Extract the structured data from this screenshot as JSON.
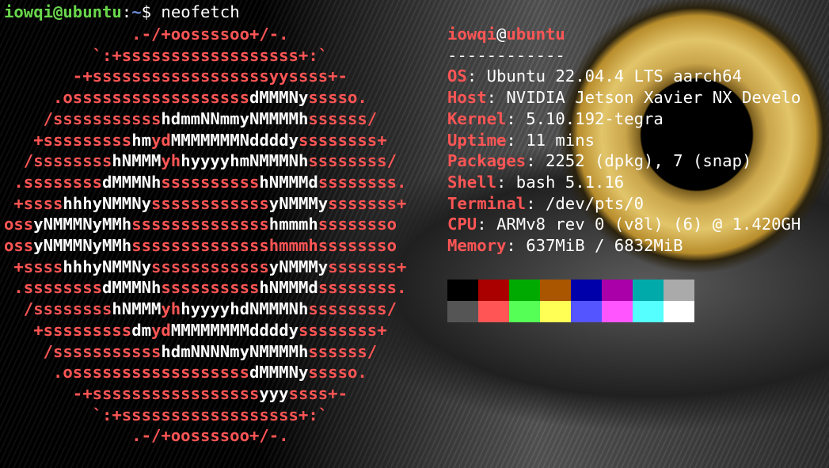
{
  "prompt": {
    "user_host": "iowqi@ubuntu",
    "separator": ":",
    "path": "~",
    "symbol": "$",
    "command": " neofetch"
  },
  "logo": {
    "colors": {
      "primary": "#ff5555",
      "secondary": "#ffffff"
    },
    "lines": [
      [
        [
          "r",
          "             .-/+oossssoo+/-."
        ]
      ],
      [
        [
          "r",
          "         `:+ssssssssssssssssss+:`"
        ]
      ],
      [
        [
          "r",
          "       -+ssssssssssssssssssyyssss+-"
        ]
      ],
      [
        [
          "r",
          "     .ossssssssssssssssss"
        ],
        [
          "w",
          "dMMMNy"
        ],
        [
          "r",
          "sssso."
        ]
      ],
      [
        [
          "r",
          "    /sssssssssss"
        ],
        [
          "w",
          "hdmmNNmmyNMMMMh"
        ],
        [
          "r",
          "ssssss/"
        ]
      ],
      [
        [
          "r",
          "   +sssssssss"
        ],
        [
          "w",
          "hm"
        ],
        [
          "r",
          "yd"
        ],
        [
          "w",
          "MMMMMMMNddddy"
        ],
        [
          "r",
          "ssssssss+"
        ]
      ],
      [
        [
          "r",
          "  /ssssssss"
        ],
        [
          "w",
          "hNMMM"
        ],
        [
          "r",
          "yh"
        ],
        [
          "w",
          "hyyyyhmNMMMNh"
        ],
        [
          "r",
          "ssssssss/"
        ]
      ],
      [
        [
          "r",
          " .ssssssss"
        ],
        [
          "w",
          "dMMMNh"
        ],
        [
          "r",
          "ssssssssss"
        ],
        [
          "w",
          "hNMMMd"
        ],
        [
          "r",
          "ssssssss."
        ]
      ],
      [
        [
          "r",
          " +ssss"
        ],
        [
          "w",
          "hhhyNMMNy"
        ],
        [
          "r",
          "ssssssssssss"
        ],
        [
          "w",
          "yNMMMy"
        ],
        [
          "r",
          "sssssss+"
        ]
      ],
      [
        [
          "r",
          "oss"
        ],
        [
          "w",
          "yNMMMNyMMh"
        ],
        [
          "r",
          "ssssssssssssss"
        ],
        [
          "w",
          "hmmmh"
        ],
        [
          "r",
          "ssssssso"
        ]
      ],
      [
        [
          "r",
          "oss"
        ],
        [
          "w",
          "yNMMMNyMMh"
        ],
        [
          "r",
          "sssssssssssssshmmmhssssssso"
        ]
      ],
      [
        [
          "r",
          " +ssss"
        ],
        [
          "w",
          "hhhyNMMNy"
        ],
        [
          "r",
          "ssssssssssss"
        ],
        [
          "w",
          "yNMMMy"
        ],
        [
          "r",
          "sssssss+"
        ]
      ],
      [
        [
          "r",
          " .ssssssss"
        ],
        [
          "w",
          "dMMMNh"
        ],
        [
          "r",
          "ssssssssss"
        ],
        [
          "w",
          "hNMMMd"
        ],
        [
          "r",
          "ssssssss."
        ]
      ],
      [
        [
          "r",
          "  /ssssssss"
        ],
        [
          "w",
          "hNMMM"
        ],
        [
          "r",
          "yh"
        ],
        [
          "w",
          "hyyyyhdNMMMNh"
        ],
        [
          "r",
          "ssssssss/"
        ]
      ],
      [
        [
          "r",
          "   +sssssssss"
        ],
        [
          "w",
          "dm"
        ],
        [
          "r",
          "yd"
        ],
        [
          "w",
          "MMMMMMMMddddy"
        ],
        [
          "r",
          "ssssssss+"
        ]
      ],
      [
        [
          "r",
          "    /sssssssssss"
        ],
        [
          "w",
          "hdmNNNNmyNMMMMh"
        ],
        [
          "r",
          "ssssss/"
        ]
      ],
      [
        [
          "r",
          "     .ossssssssssssssssss"
        ],
        [
          "w",
          "dMMMNy"
        ],
        [
          "r",
          "sssso."
        ]
      ],
      [
        [
          "r",
          "       -+sssssssssssssssss"
        ],
        [
          "w",
          "yyy"
        ],
        [
          "r",
          "ssss+-"
        ]
      ],
      [
        [
          "r",
          "         `:+ssssssssssssssssss+:`"
        ]
      ],
      [
        [
          "r",
          "             .-/+oossssoo+/-."
        ]
      ]
    ]
  },
  "info": {
    "title_user": "iowqi",
    "title_at": "@",
    "title_host": "ubuntu",
    "divider": "------------",
    "rows": [
      {
        "label": "OS",
        "value": ": Ubuntu 22.04.4 LTS aarch64"
      },
      {
        "label": "Host",
        "value": ": NVIDIA Jetson Xavier NX Develo"
      },
      {
        "label": "Kernel",
        "value": ": 5.10.192-tegra"
      },
      {
        "label": "Uptime",
        "value": ": 11 mins"
      },
      {
        "label": "Packages",
        "value": ": 2252 (dpkg), 7 (snap)"
      },
      {
        "label": "Shell",
        "value": ": bash 5.1.16"
      },
      {
        "label": "Terminal",
        "value": ": /dev/pts/0"
      },
      {
        "label": "CPU",
        "value": ": ARMv8 rev 0 (v8l) (6) @ 1.420GH"
      },
      {
        "label": "Memory",
        "value": ": 637MiB / 6832MiB"
      }
    ]
  },
  "palette": {
    "row1": [
      "#000000",
      "#aa0000",
      "#00aa00",
      "#aa5500",
      "#0000aa",
      "#aa00aa",
      "#00aaaa",
      "#aaaaaa"
    ],
    "row2": [
      "#555555",
      "#ff5555",
      "#55ff55",
      "#ffff55",
      "#5555ff",
      "#ff55ff",
      "#55ffff",
      "#ffffff"
    ]
  }
}
